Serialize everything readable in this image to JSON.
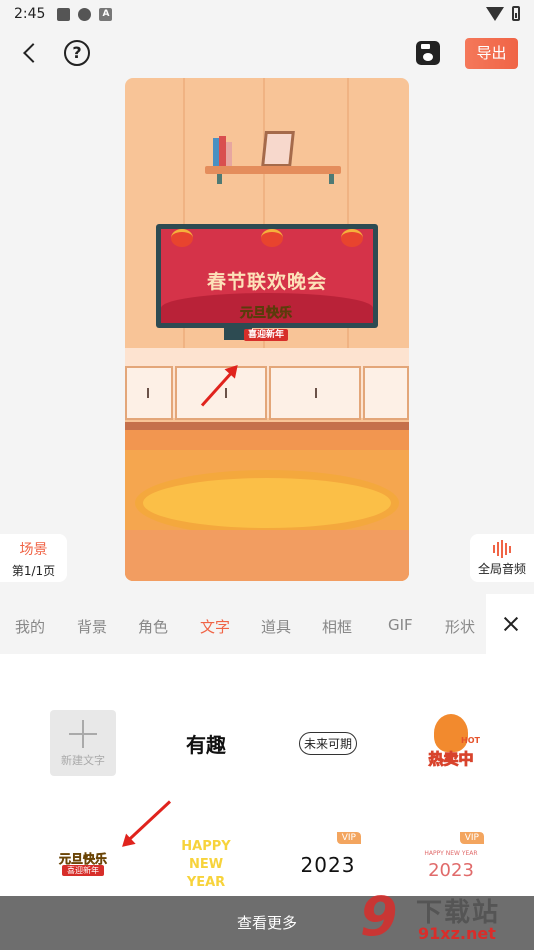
{
  "status_bar": {
    "time": "2:45",
    "icon_a": "A"
  },
  "toolbar": {
    "export_label": "导出",
    "help_glyph": "?"
  },
  "canvas": {
    "tv_title": "春节联欢晚会",
    "sticker_top": "元旦快乐",
    "sticker_bottom": "喜迎新年"
  },
  "scene": {
    "title": "场景",
    "page": "第1/1页"
  },
  "audio": {
    "label": "全局音频"
  },
  "tabs": [
    {
      "label": "我的"
    },
    {
      "label": "背景"
    },
    {
      "label": "角色"
    },
    {
      "label": "文字"
    },
    {
      "label": "道具"
    },
    {
      "label": "相框"
    },
    {
      "label": "GIF"
    },
    {
      "label": "形状"
    }
  ],
  "active_tab": "文字",
  "stickers": {
    "new_text": "新建文字",
    "youqu": "有趣",
    "weilai": "未来可期",
    "remai": "热卖中",
    "hot": "HOT",
    "yuandan": "元旦快乐",
    "yuandan_sub": "喜迎新年",
    "happy_new_year": "HAPPY NEW YEAR",
    "year_2023": "2023",
    "year_2023_b": "2023",
    "happy_new_year_small": "HAPPY NEW YEAR",
    "vip": "VIP",
    "vip2": "VIP"
  },
  "bottom": {
    "more_label": "查看更多"
  },
  "watermark": {
    "nine": "9",
    "main": "下载站",
    "sub": "91xz.net"
  },
  "colors": {
    "accent": "#f06446",
    "arrow": "#e0231d"
  }
}
